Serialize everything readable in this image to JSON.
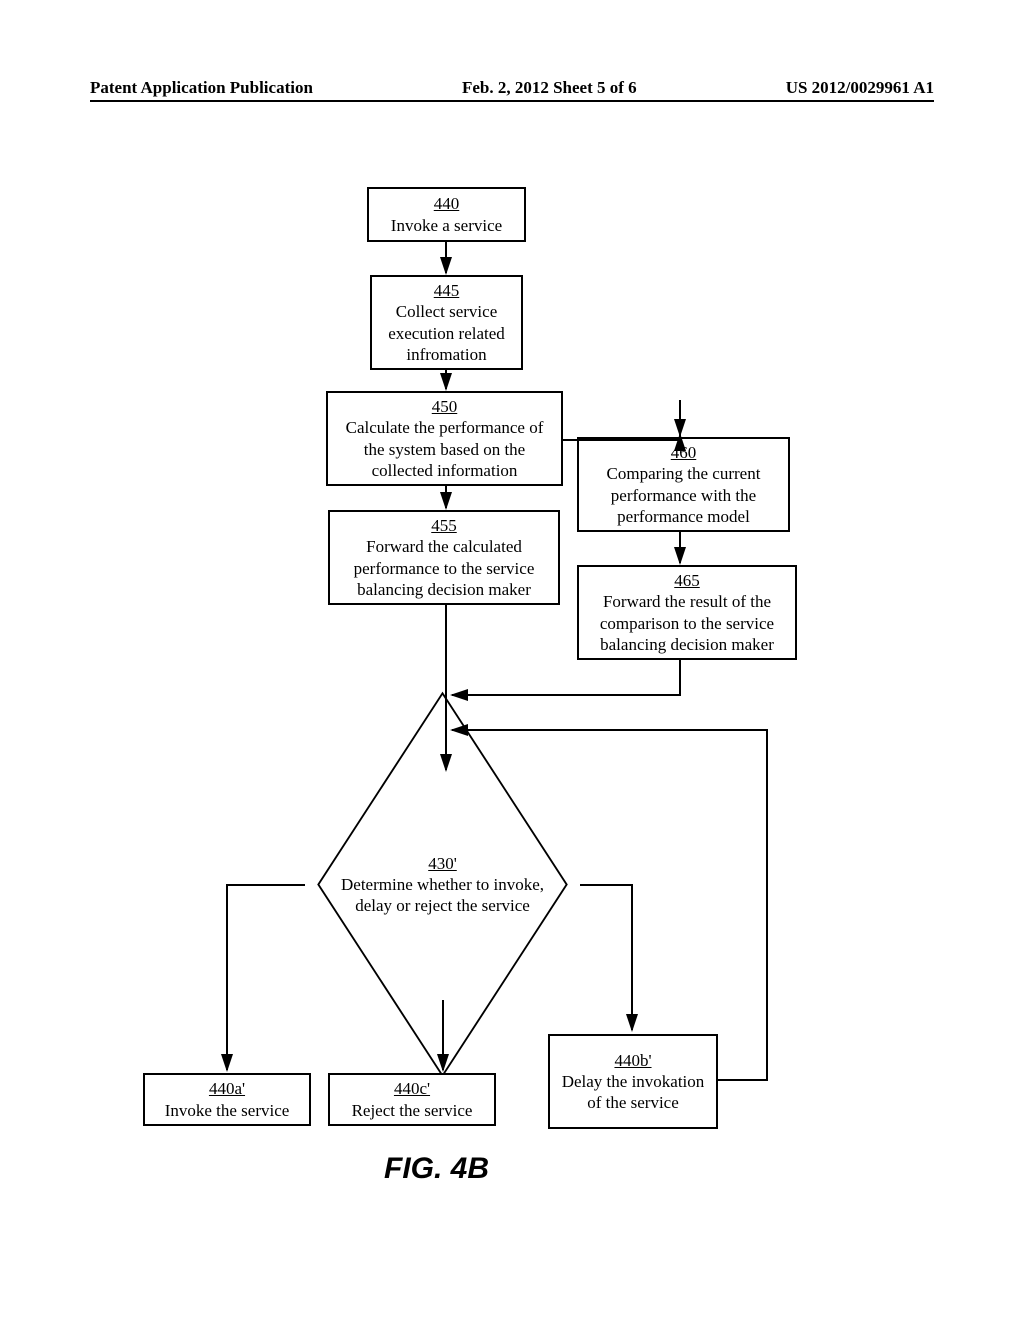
{
  "header": {
    "left": "Patent Application Publication",
    "center": "Feb. 2, 2012   Sheet 5 of 6",
    "right": "US 2012/0029961 A1"
  },
  "nodes": {
    "n440": {
      "ref": "440",
      "text": "Invoke a service"
    },
    "n445": {
      "ref": "445",
      "text": "Collect service execution related infromation"
    },
    "n450": {
      "ref": "450",
      "text": "Calculate the performance of the system based on the collected information"
    },
    "n455": {
      "ref": "455",
      "text": "Forward the calculated performance to the service balancing decision maker"
    },
    "n460": {
      "ref": "460",
      "text": "Comparing the current performance with the performance model"
    },
    "n465": {
      "ref": "465",
      "text": "Forward the result of the comparison to the service balancing decision maker"
    },
    "n430p": {
      "ref": "430'",
      "text": "Determine whether to invoke, delay or reject the service"
    },
    "n440a": {
      "ref": "440a'",
      "text": "Invoke the service"
    },
    "n440c": {
      "ref": "440c'",
      "text": "Reject the service"
    },
    "n440b": {
      "ref": "440b'",
      "text": "Delay the invokation of the service"
    }
  },
  "figure_caption": "FIG. 4B"
}
